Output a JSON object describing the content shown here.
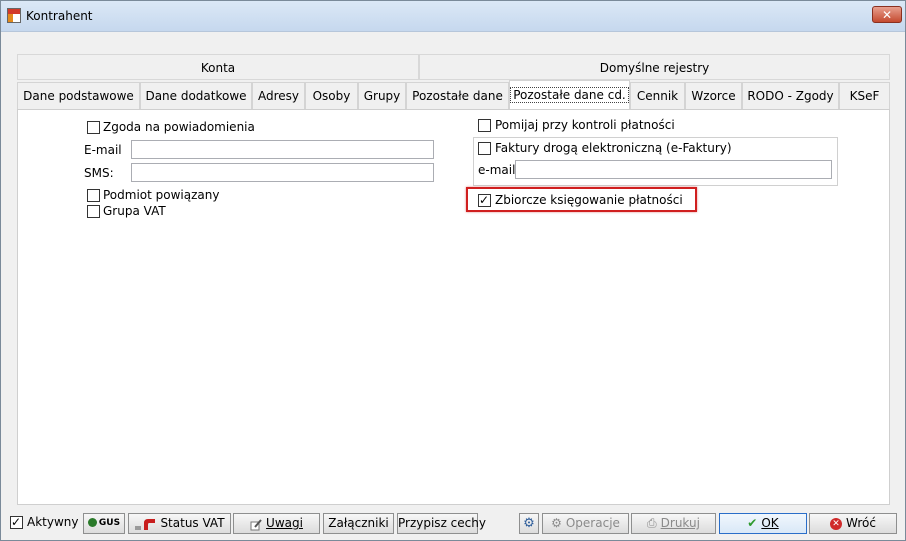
{
  "window": {
    "title": "Kontrahent",
    "close_glyph": "✕"
  },
  "group_headers": [
    "Konta",
    "Domyślne rejestry"
  ],
  "tabs": [
    "Dane podstawowe",
    "Dane dodatkowe",
    "Adresy",
    "Osoby",
    "Grupy",
    "Pozostałe dane",
    "Pozostałe dane cd.",
    "Cennik",
    "Wzorce",
    "RODO - Zgody",
    "KSeF"
  ],
  "active_tab": "Pozostałe dane cd.",
  "left": {
    "notify_consent": {
      "label": "Zgoda na powiadomienia",
      "checked": false
    },
    "email_label": "E-mail",
    "email_value": "",
    "sms_label": "SMS:",
    "sms_value": "",
    "related_entity": {
      "label": "Podmiot powiązany",
      "checked": false
    },
    "vat_group": {
      "label": "Grupa VAT",
      "checked": false
    }
  },
  "right": {
    "skip_payment_check": {
      "label": "Pomijaj przy kontroli płatności",
      "checked": false
    },
    "e_invoices": {
      "label": "Faktury drogą elektroniczną (e-Faktury)",
      "checked": false
    },
    "e_invoice_email_label": "e-mail",
    "e_invoice_email_value": "",
    "collective_posting": {
      "label": "Zbiorcze księgowanie płatności",
      "checked": true
    }
  },
  "footer": {
    "active": {
      "label": "Aktywny",
      "checked": true
    },
    "gus": "GUS",
    "status_vat": "Status VAT",
    "notes": "Uwagi",
    "attachments": "Załączniki",
    "assign_features": "Przypisz cechy",
    "operations": "Operacje",
    "print": "Drukuj",
    "ok": "OK",
    "back": "Wróć"
  },
  "colors": {
    "highlight": "#d01f1f",
    "ok_border": "#2a6ec9",
    "titlebar": "#c6d8ee"
  }
}
